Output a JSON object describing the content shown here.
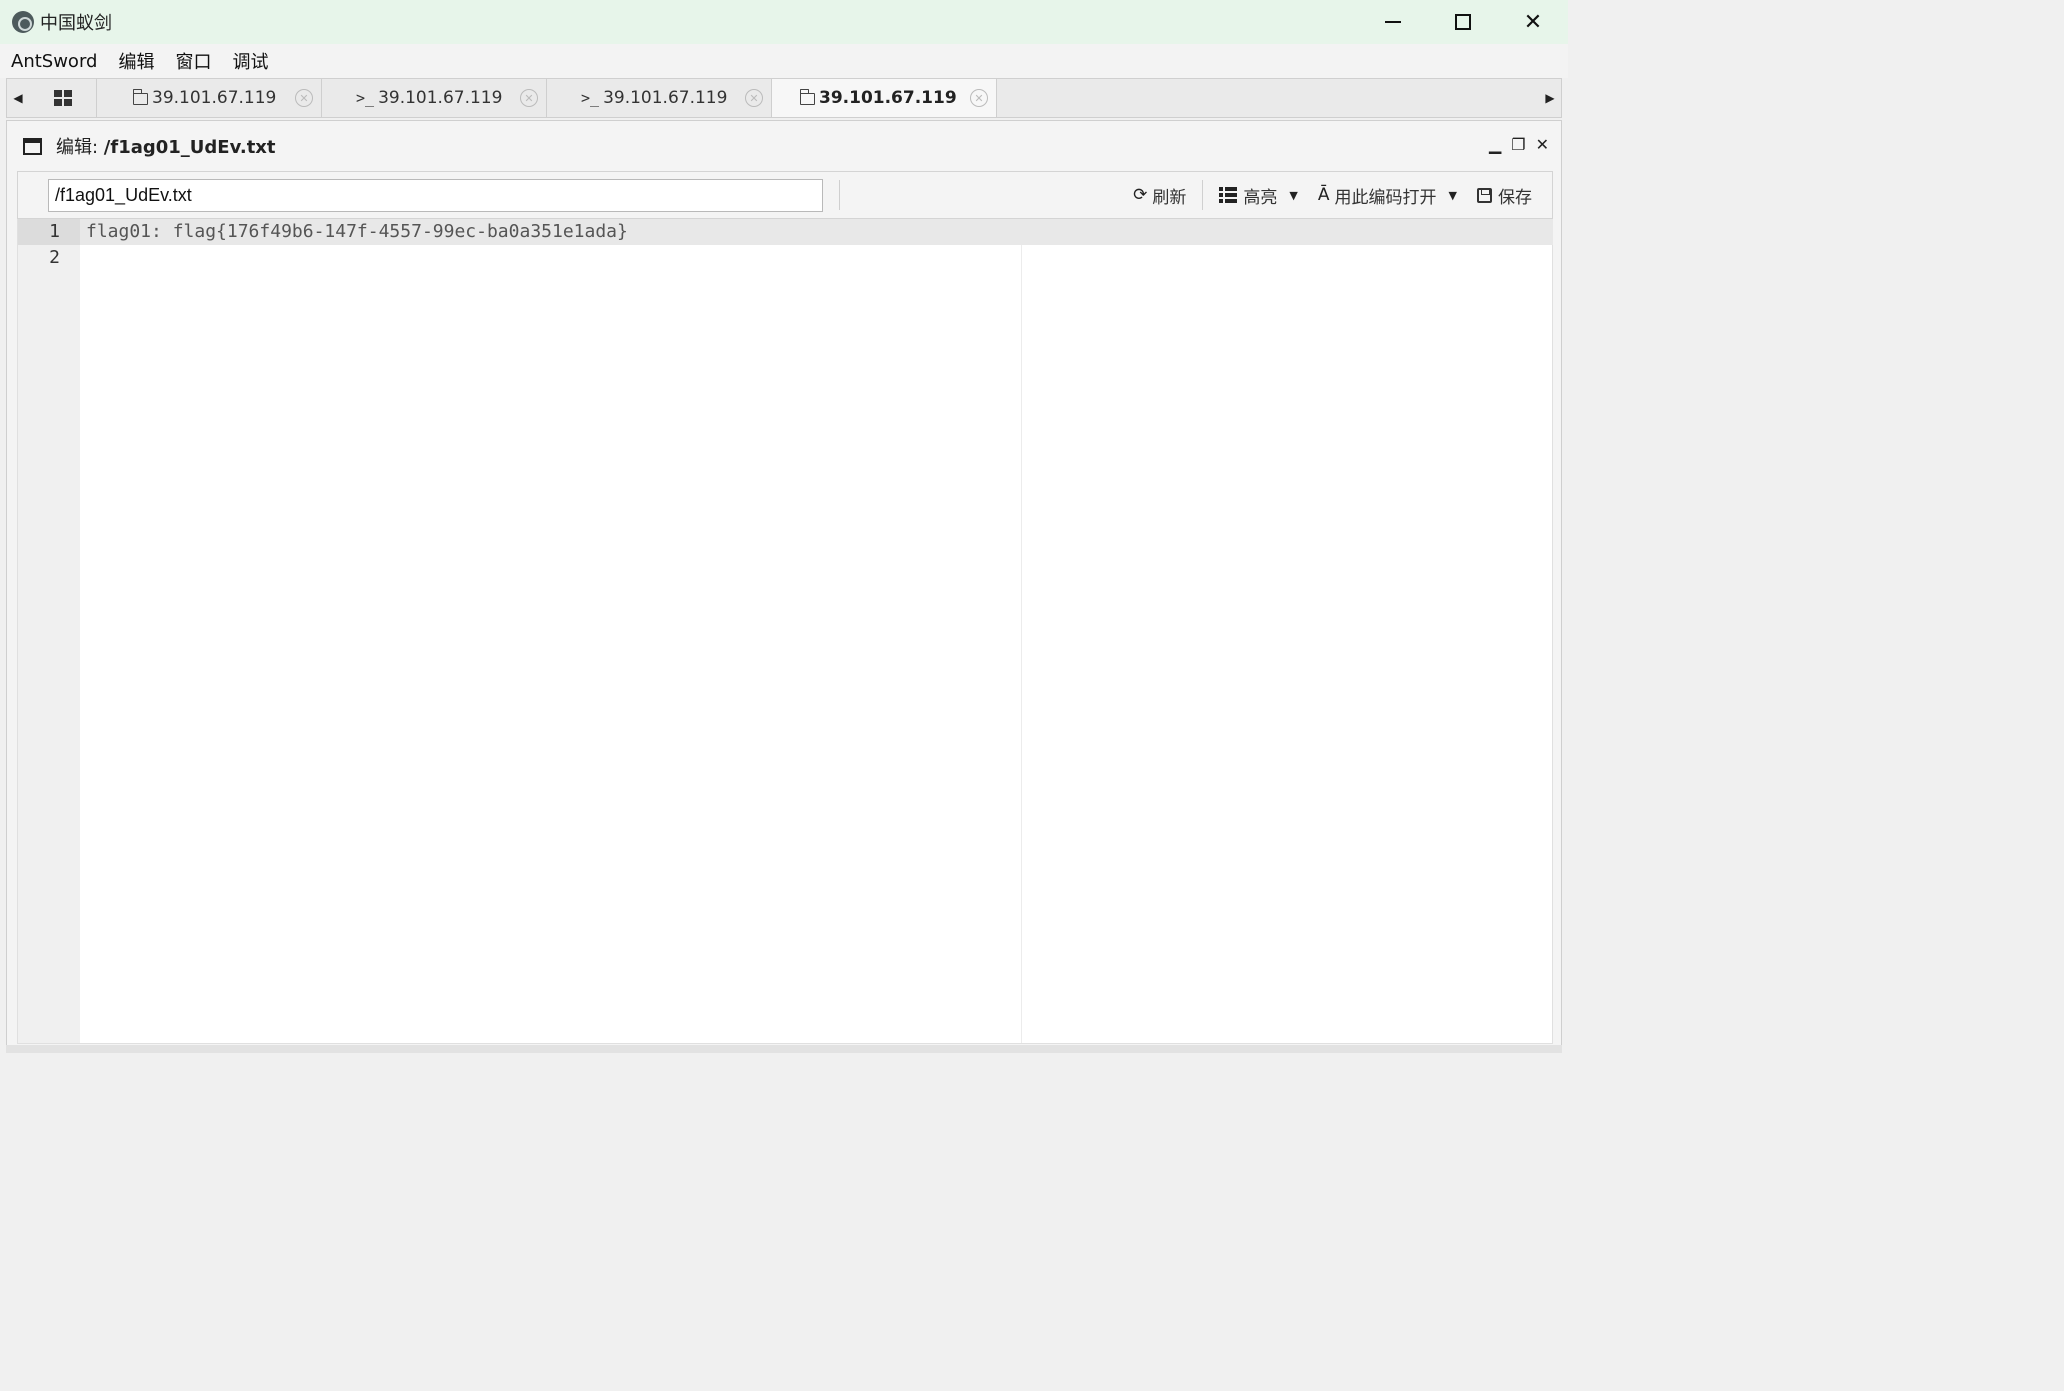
{
  "window": {
    "title": "中国蚁剑",
    "controls": {
      "minimize": "—",
      "maximize": "☐",
      "close": "✕"
    }
  },
  "menu": {
    "items": [
      {
        "label": "AntSword"
      },
      {
        "label": "编辑"
      },
      {
        "label": "窗口"
      },
      {
        "label": "调试"
      }
    ]
  },
  "tabs": [
    {
      "icon": "grid-icon",
      "label": ""
    },
    {
      "icon": "folder-icon",
      "label": "39.101.67.119"
    },
    {
      "icon": "terminal-icon",
      "prefix": ">_",
      "label": "39.101.67.119"
    },
    {
      "icon": "terminal-icon",
      "prefix": ">_",
      "label": "39.101.67.119"
    },
    {
      "icon": "folder-icon",
      "label": "39.101.67.119",
      "active": true
    }
  ],
  "editor": {
    "title_prefix": "编辑: ",
    "title_path": "/f1ag01_UdEv.txt",
    "path_value": "/f1ag01_UdEv.txt",
    "toolbar": {
      "refresh_label": "刷新",
      "highlight_label": "高亮",
      "open_with_encoding_label": "用此编码打开",
      "save_label": "保存"
    },
    "lines": [
      {
        "number": "1",
        "text": "flag01: flag{176f49b6-147f-4557-99ec-ba0a351e1ada}"
      },
      {
        "number": "2",
        "text": ""
      }
    ]
  }
}
